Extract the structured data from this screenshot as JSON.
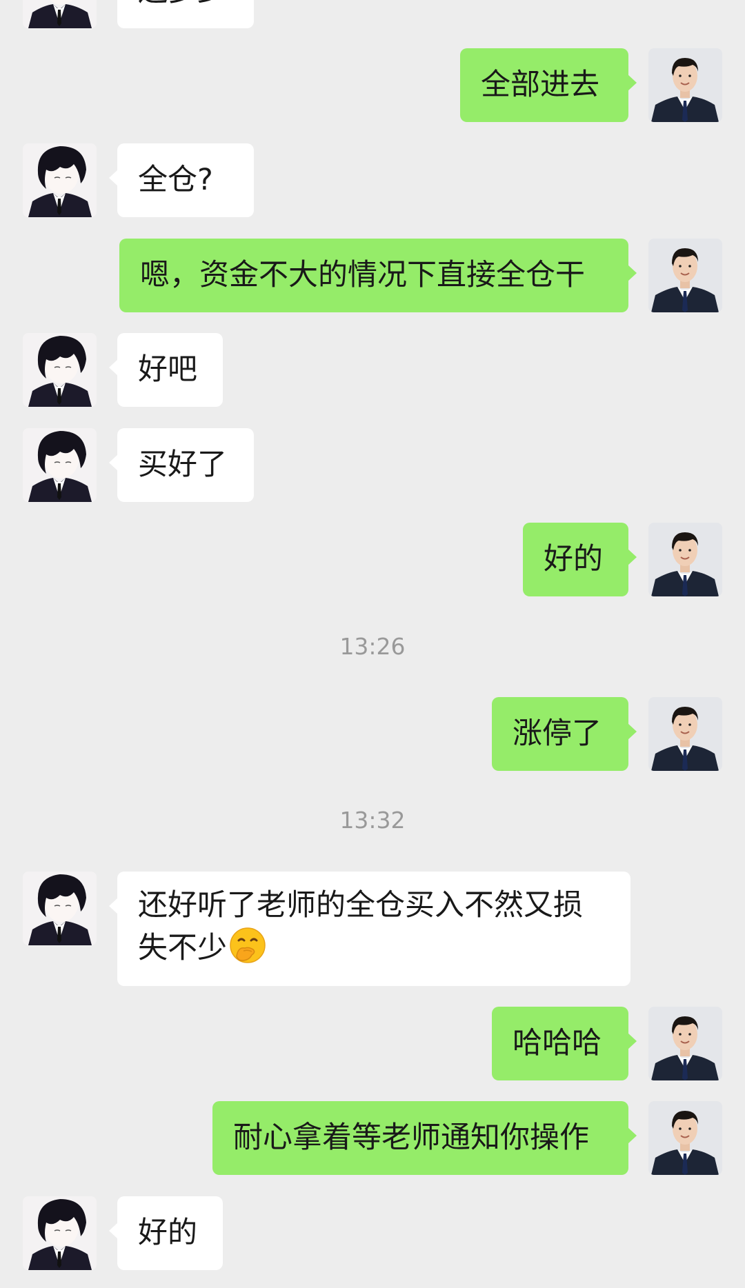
{
  "messages": {
    "m0": "还多少",
    "m1": "全部进去",
    "m2": "全仓?",
    "m3": "嗯，资金不大的情况下直接全仓干",
    "m4": "好吧",
    "m5": "买好了",
    "m6": "好的",
    "m7": "涨停了",
    "m8": "还好听了老师的全仓买入不然又损失不少",
    "m9": "哈哈哈",
    "m10": "耐心拿着等老师通知你操作",
    "m11": "好的"
  },
  "timestamps": {
    "t1": "13:26",
    "t2": "13:32"
  },
  "icons": {
    "left_avatar": "anime-boy-avatar-icon",
    "right_avatar": "businessman-avatar-icon",
    "emoji": "face-with-hand-over-mouth-emoji"
  },
  "colors": {
    "background": "#ededed",
    "self_bubble": "#95ec69",
    "other_bubble": "#ffffff"
  }
}
